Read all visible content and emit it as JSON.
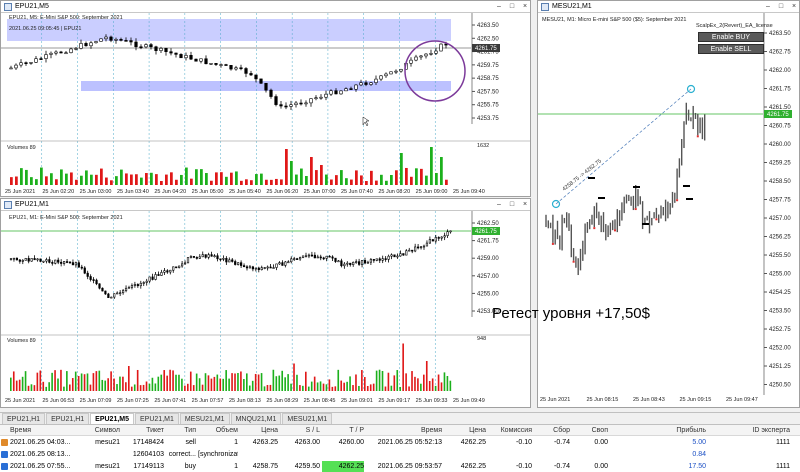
{
  "windows": {
    "w1": {
      "title": "EPU21,M5",
      "info": "EPU21, M5:  E-Mini S&P 500: September 2021",
      "info2": "2021.06.25 09:05:45 | EPU21",
      "prices": [
        "4263.50",
        "4262.50",
        "4261.75",
        "4259.75",
        "4258.75",
        "4257.50",
        "4255.75",
        "4253.75"
      ],
      "current": "4261.75",
      "vol_label": "Volumes 89",
      "vol_top": "1632",
      "times": [
        "25 Jun 2021",
        "25 Jun 02:20",
        "25 Jun 03:00",
        "25 Jun 03:40",
        "25 Jun 04:20",
        "25 Jun 05:00",
        "25 Jun 05:40",
        "25 Jun 06:20",
        "25 Jun 07:00",
        "25 Jun 07:40",
        "25 Jun 08:20",
        "25 Jun 09:00",
        "25 Jun 09:40"
      ]
    },
    "w2": {
      "title": "EPU21,M1",
      "info": "EPU21, M1:  E-Mini S&P 500: September 2021",
      "prices": [
        "4262.50",
        "4261.75",
        "4259.00",
        "4257.00",
        "4255.00",
        "4253.00"
      ],
      "current": "4261.75",
      "vol_label": "Volumes 89",
      "vol_top": "948",
      "times": [
        "25 Jun 2021",
        "25 Jun 06:53",
        "25 Jun 07:09",
        "25 Jun 07:25",
        "25 Jun 07:41",
        "25 Jun 07:57",
        "25 Jun 08:13",
        "25 Jun 08:29",
        "25 Jun 08:45",
        "25 Jun 09:01",
        "25 Jun 09:17",
        "25 Jun 09:33",
        "25 Jun 09:49"
      ]
    },
    "w3": {
      "title": "MESU21,M1",
      "info": "MESU21, M1:  Micro E-mini S&P 500 ($5): September 2021",
      "ea": "ScalpEx_2(Revert)_EA_license",
      "btn_buy": "Enable BUY",
      "btn_sell": "Enable SELL",
      "ann": "4258.75 -> 4262.75",
      "prices": [
        "4263.50",
        "4262.75",
        "4262.00",
        "4261.75",
        "4261.50",
        "4260.75",
        "4260.00",
        "4259.25",
        "4258.50",
        "4257.75",
        "4257.00",
        "4256.25",
        "4255.50",
        "4255.00",
        "4254.25",
        "4253.50",
        "4252.75",
        "4252.00",
        "4251.25",
        "4250.50"
      ],
      "current": "4261.75",
      "times": [
        "25 Jun 2021",
        "25 Jun 08:15",
        "25 Jun 08:43",
        "25 Jun 09:15",
        "25 Jun 09:47"
      ]
    }
  },
  "overlay_text": "Ретест уровня +17,50$",
  "tabs": [
    "EPU21,H1",
    "EPU21,H1",
    "EPU21,M5",
    "EPU21,M1",
    "MESU21,M1",
    "MNQU21,M1",
    "MESU21,M1"
  ],
  "active_tab_index": 2,
  "terminal": {
    "headers": [
      "Время",
      "Символ",
      "Тикет",
      "Тип",
      "Объем",
      "Цена",
      "S / L",
      "T / P",
      "Время",
      "Цена",
      "Комиссия",
      "Сбор",
      "Своп",
      "Прибыль",
      "ID эксперта"
    ],
    "rows": [
      {
        "time": "2021.06.25 04:03...",
        "symbol": "mesu21",
        "ticket": "17148424",
        "type": "sell",
        "volume": "1",
        "price": "4263.25",
        "sl": "4263.00",
        "tp": "4260.00",
        "time2": "2021.06.25 05:52:13",
        "price2": "4262.25",
        "commission": "-0.10",
        "fee": "-0.74",
        "swap": "0.00",
        "profit": "5.00",
        "id": "1111",
        "icon": "#e08a2a"
      },
      {
        "time": "2021.06.25 08:13...",
        "symbol": "",
        "ticket": "12604103",
        "type": "correct...",
        "volume": "[synchronization]",
        "price": "",
        "sl": "",
        "tp": "",
        "time2": "",
        "price2": "",
        "commission": "",
        "fee": "",
        "swap": "",
        "profit": "0.84",
        "id": "",
        "icon": "#2a6fd6"
      },
      {
        "time": "2021.06.25 07:55...",
        "symbol": "mesu21",
        "ticket": "17149113",
        "type": "buy",
        "volume": "1",
        "price": "4258.75",
        "sl": "4259.50",
        "tp": "4262.25",
        "time2": "2021.06.25 09:53:57",
        "price2": "4262.25",
        "commission": "-0.10",
        "fee": "-0.74",
        "swap": "0.00",
        "profit": "17.50",
        "id": "1111",
        "icon": "#2a6fd6"
      }
    ]
  },
  "colors": {
    "zone": "#9fa6ff",
    "vol_up": "#1cb01c",
    "vol_down": "#e01818",
    "line_green": "#30b030",
    "circle": "#7c3a9a",
    "marker": "#2ab0d0",
    "tp_hl": "#55e055"
  }
}
